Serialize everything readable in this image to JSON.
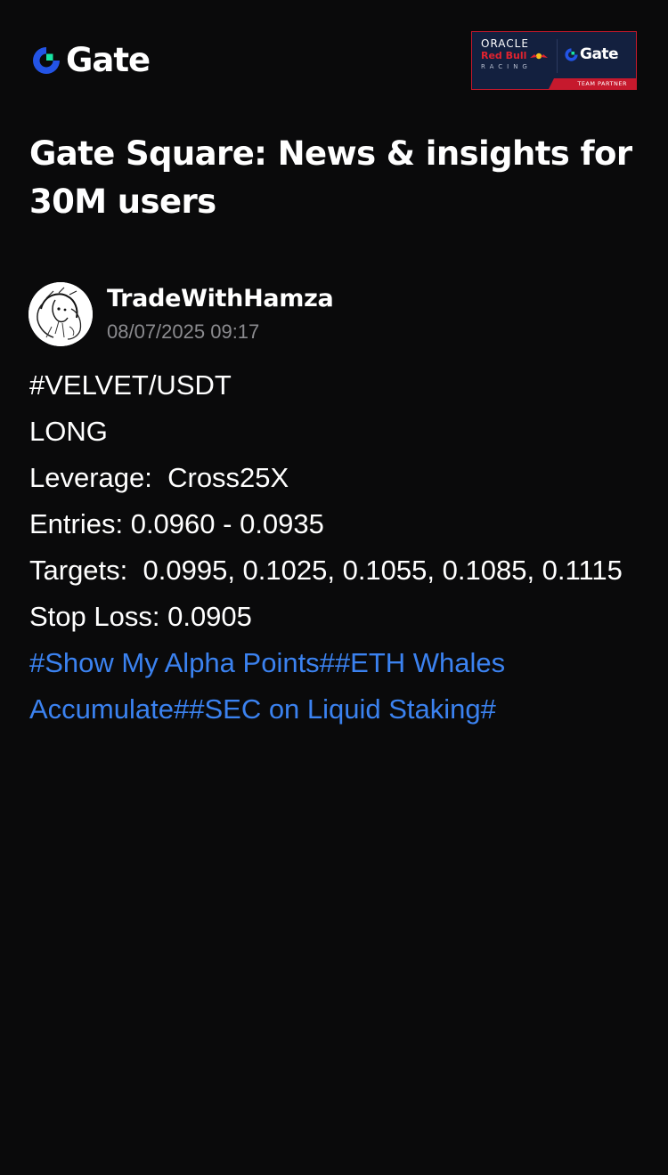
{
  "brand": {
    "logo_text": "Gate",
    "accent_color": "#2354e6",
    "accent_green": "#17e5a3"
  },
  "partner_badge": {
    "oracle": "ORACLE",
    "red_bull": "Red Bull",
    "racing": "RACING",
    "gate_text": "Gate",
    "strip_text": "TEAM PARTNER"
  },
  "page": {
    "title": "Gate Square: News & insights for 30M users"
  },
  "post": {
    "author": "TradeWithHamza",
    "timestamp": "08/07/2025 09:17",
    "lines": [
      "#VELVET/USDT",
      "LONG",
      "Leverage:  Cross25X",
      "Entries: 0.0960 - 0.0935",
      "Targets:  0.0995, 0.1025, 0.1055, 0.1085, 0.1115",
      "Stop Loss: 0.0905"
    ],
    "hashtags": [
      "#Show My Alpha Points#",
      "#ETH Whales Accumulate#",
      "#SEC on Liquid Staking#"
    ],
    "hashtag_color": "#3b82f0"
  }
}
